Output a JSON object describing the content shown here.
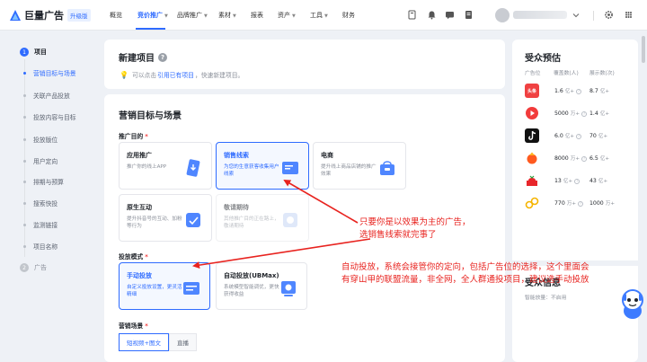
{
  "header": {
    "logo_text": "巨量广告",
    "logo_badge": "升级版",
    "nav": [
      {
        "label": "概览",
        "caret": false
      },
      {
        "label": "竞价推广",
        "caret": true
      },
      {
        "label": "品牌推广",
        "caret": true
      },
      {
        "label": "素材",
        "caret": true
      },
      {
        "label": "报表",
        "caret": false
      },
      {
        "label": "资产",
        "caret": true
      },
      {
        "label": "工具",
        "caret": true
      },
      {
        "label": "财务",
        "caret": false
      }
    ]
  },
  "steps": {
    "step1": {
      "num": "1",
      "label": "项目"
    },
    "sub": [
      "营销目标与场景",
      "关联产品投放",
      "投放内容与目标",
      "投放版位",
      "用户定向",
      "排期与预算",
      "搜索快投",
      "监测链接",
      "项目名称"
    ],
    "step2": {
      "num": "2",
      "label": "广告"
    }
  },
  "new_project": {
    "title": "新建项目",
    "tip_prefix": "可以点击",
    "tip_link": "引用已有项目",
    "tip_suffix": "，快速新建项目。"
  },
  "goal": {
    "title": "营销目标与场景",
    "promo_label": "推广目的",
    "promo_cards": [
      {
        "title": "应用推广",
        "desc": "推广你的线上APP"
      },
      {
        "title": "销售线索",
        "desc": "为您的生意获客收集用户线索"
      },
      {
        "title": "电商",
        "desc": "提升线上商品店铺的推广效果"
      },
      {
        "title": "原生互动",
        "desc": "提升抖音号的互动、加粉等行为"
      },
      {
        "title": "敬请期待",
        "desc": "其他推广目的正在路上，敬请期待"
      }
    ],
    "delivery_label": "投放模式",
    "delivery_cards": [
      {
        "title": "手动投放",
        "desc": "自定义投放设置，更灵活精细"
      },
      {
        "title": "自动投放(UBMax)",
        "desc": "系统模型智能调优，更快获得收益"
      }
    ],
    "scene_label": "营销场景",
    "scene_tabs": [
      "短视频+图文",
      "直播"
    ]
  },
  "audience": {
    "title": "受众预估",
    "col_platform": "广告位",
    "col_cover": "覆盖数(人)",
    "col_show": "展示数(次)",
    "rows": [
      {
        "platform": "头条",
        "cover": "1.6",
        "cover_unit": "亿+",
        "show": "8.7",
        "show_unit": "亿+",
        "color": "#f04142"
      },
      {
        "platform": "西瓜",
        "cover": "5000",
        "cover_unit": "万+",
        "show": "1.4",
        "show_unit": "亿+",
        "color": "#f23b3b"
      },
      {
        "platform": "抖音",
        "cover": "6.0",
        "cover_unit": "亿+",
        "show": "70",
        "show_unit": "亿+",
        "color": "#111111"
      },
      {
        "platform": "火山",
        "cover": "8000",
        "cover_unit": "万+",
        "show": "6.5",
        "show_unit": "亿+",
        "color": "#ff5a1f"
      },
      {
        "platform": "番茄",
        "cover": "13",
        "cover_unit": "亿+",
        "show": "43",
        "show_unit": "亿+",
        "color": "#e8262b"
      },
      {
        "platform": "穿山甲",
        "cover": "770",
        "cover_unit": "万+",
        "show": "1000",
        "show_unit": "万+",
        "color": "#f5b400"
      }
    ],
    "info_title": "受众信息",
    "info_sub": "智能放量：不启用"
  },
  "annotations": {
    "first_line1": "只要你是以效果为主的广告，",
    "first_line2": "选销售线索就完事了",
    "second_line1": "自动投放，系统会接管你的定向，包括广告位的选择，这个里面会",
    "second_line2": "有穿山甲的联盟流量，非全网，全人群通投项目，建议选手动投放"
  },
  "colors": {
    "accent": "#2e6bff",
    "annotation": "#e8231f"
  }
}
